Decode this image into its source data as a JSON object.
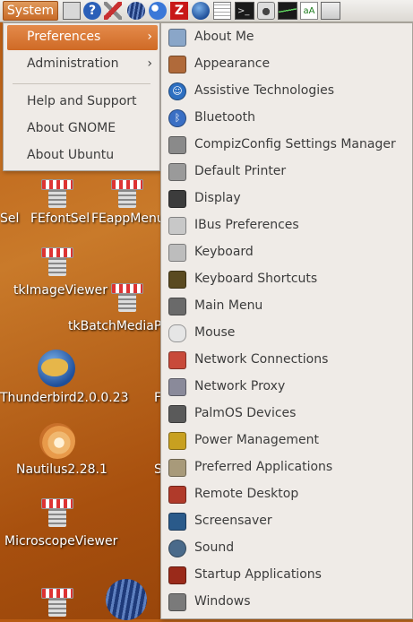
{
  "panel": {
    "system_label": "System",
    "launchers": [
      "calculator-icon",
      "help-icon",
      "tools-icon",
      "globe-icon",
      "firefox-alt-icon",
      "filezilla-icon",
      "thunderbird-icon",
      "text-editor-icon",
      "terminal-icon",
      "camera-icon",
      "system-monitor-icon",
      "font-viewer-icon",
      "screen-icon"
    ]
  },
  "system_menu": {
    "items": [
      {
        "label": "Preferences"
      },
      {
        "label": "Administration"
      },
      {
        "label": "Help and Support"
      },
      {
        "label": "About GNOME"
      },
      {
        "label": "About Ubuntu"
      }
    ]
  },
  "preferences_menu": {
    "items": [
      {
        "label": "About Me",
        "icon": "about-me-icon",
        "color": "#8aa6c8"
      },
      {
        "label": "Appearance",
        "icon": "appearance-icon",
        "color": "#b06a3a"
      },
      {
        "label": "Assistive Technologies",
        "icon": "accessibility-icon",
        "color": "#2d6fc1"
      },
      {
        "label": "Bluetooth",
        "icon": "bluetooth-icon",
        "color": "#3a6fc4"
      },
      {
        "label": "CompizConfig Settings Manager",
        "icon": "compiz-icon",
        "color": "#8a8a8a"
      },
      {
        "label": "Default Printer",
        "icon": "printer-icon",
        "color": "#9a9a9a"
      },
      {
        "label": "Display",
        "icon": "display-icon",
        "color": "#3c3c3c"
      },
      {
        "label": "IBus Preferences",
        "icon": "ibus-icon",
        "color": "#c8c8c8"
      },
      {
        "label": "Keyboard",
        "icon": "keyboard-icon",
        "color": "#bdbdbd"
      },
      {
        "label": "Keyboard Shortcuts",
        "icon": "keyboard-shortcuts-icon",
        "color": "#5a4a20"
      },
      {
        "label": "Main Menu",
        "icon": "main-menu-icon",
        "color": "#6a6a6a"
      },
      {
        "label": "Mouse",
        "icon": "mouse-icon",
        "color": "#e6e6e6"
      },
      {
        "label": "Network Connections",
        "icon": "network-connections-icon",
        "color": "#c84a3a"
      },
      {
        "label": "Network Proxy",
        "icon": "network-proxy-icon",
        "color": "#8a8a9a"
      },
      {
        "label": "PalmOS Devices",
        "icon": "palm-device-icon",
        "color": "#5a5a5a"
      },
      {
        "label": "Power Management",
        "icon": "power-icon",
        "color": "#c8a020"
      },
      {
        "label": "Preferred Applications",
        "icon": "preferred-apps-icon",
        "color": "#a89a7a"
      },
      {
        "label": "Remote Desktop",
        "icon": "remote-desktop-icon",
        "color": "#b03a2a"
      },
      {
        "label": "Screensaver",
        "icon": "screensaver-icon",
        "color": "#2a5a8a"
      },
      {
        "label": "Sound",
        "icon": "sound-icon",
        "color": "#4a6a8a"
      },
      {
        "label": "Startup Applications",
        "icon": "startup-apps-icon",
        "color": "#9a2a1a"
      },
      {
        "label": "Windows",
        "icon": "windows-icon",
        "color": "#7a7a7a"
      }
    ]
  },
  "desktop": {
    "labels": [
      "Sel",
      "FEfontSel",
      "FEappMenu",
      "tkImageViewer",
      "tkBatchMediaPl",
      "Thunderbird2.0.0.23",
      "F",
      "Nautilus2.28.1",
      "S",
      "MicroscopeViewer"
    ]
  },
  "colors": {
    "accent": "#d9702f",
    "menu_bg": "#efebe7"
  }
}
